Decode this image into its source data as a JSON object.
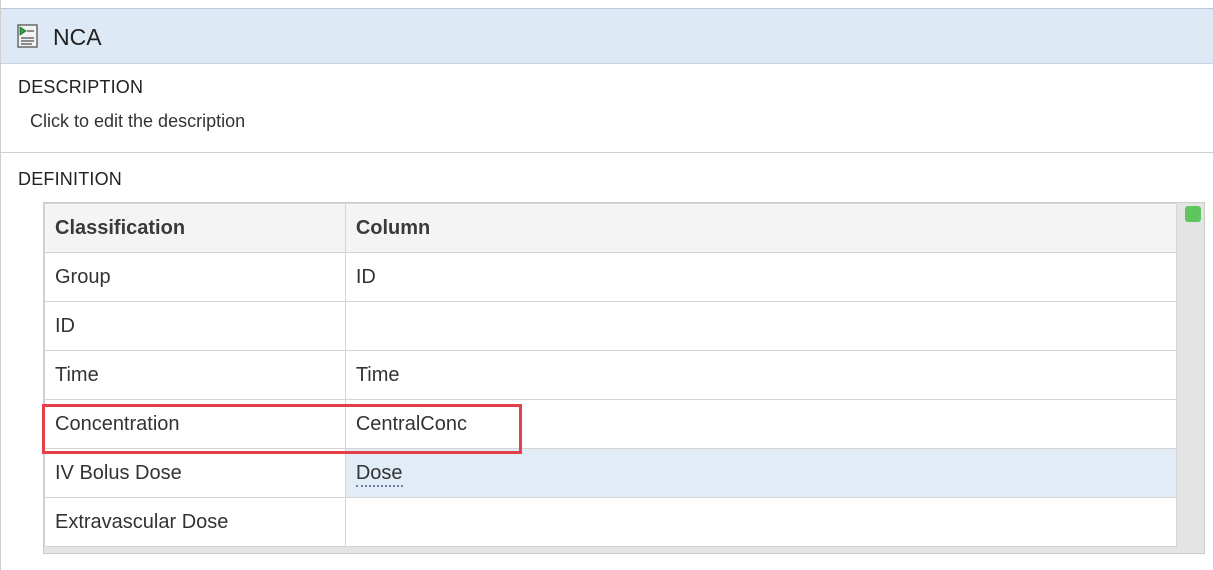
{
  "header": {
    "title": "NCA",
    "icon": "script-document-icon"
  },
  "description": {
    "heading": "DESCRIPTION",
    "text": "Click to edit the description"
  },
  "definition": {
    "heading": "DEFINITION",
    "columns": [
      "Classification",
      "Column"
    ],
    "rows": [
      {
        "classification": "Group",
        "column": "ID"
      },
      {
        "classification": "ID",
        "column": ""
      },
      {
        "classification": "Time",
        "column": "Time"
      },
      {
        "classification": "Concentration",
        "column": "CentralConc"
      },
      {
        "classification": "IV Bolus Dose",
        "column": "Dose"
      },
      {
        "classification": "Extravascular Dose",
        "column": ""
      }
    ],
    "selected_row": "IV Bolus Dose",
    "highlighted_row": "Concentration",
    "status_color": "#5fc65f"
  },
  "colors": {
    "title_bar": "#dde9f5",
    "selected_cell": "#e1ecf7",
    "highlight_border": "#e5404a"
  }
}
